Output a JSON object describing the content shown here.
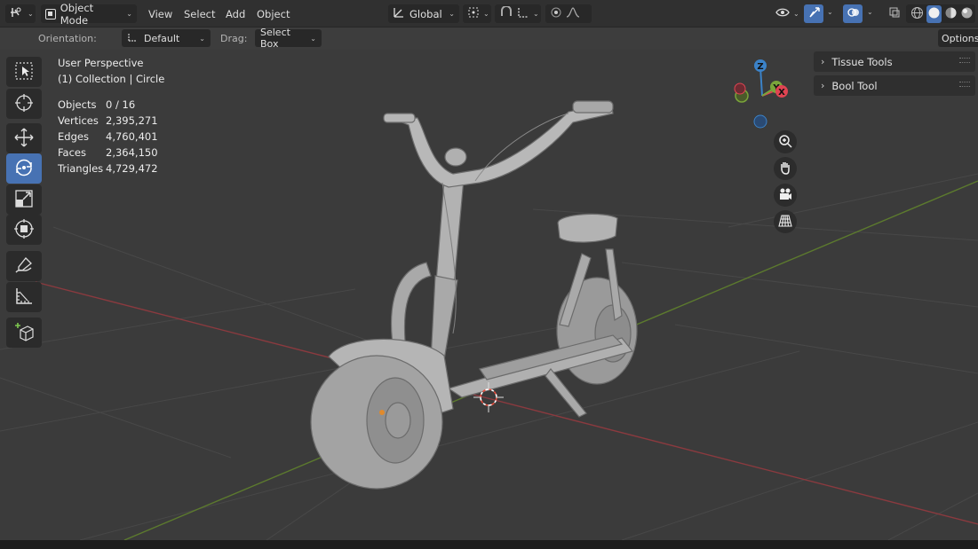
{
  "header": {
    "mode_label": "Object Mode",
    "menu": [
      "View",
      "Select",
      "Add",
      "Object"
    ],
    "transform_orientation": "Global"
  },
  "tool_settings": {
    "orientation_label": "Orientation:",
    "orientation_value": "Default",
    "drag_label": "Drag:",
    "drag_value": "Select Box",
    "options_label": "Options"
  },
  "viewport_info": {
    "view_name": "User Perspective",
    "collection": "(1) Collection | Circle"
  },
  "stats": [
    {
      "label": "Objects",
      "value": "0 / 16"
    },
    {
      "label": "Vertices",
      "value": "2,395,271"
    },
    {
      "label": "Edges",
      "value": "4,760,401"
    },
    {
      "label": "Faces",
      "value": "2,364,150"
    },
    {
      "label": "Triangles",
      "value": "4,729,472"
    }
  ],
  "panels": [
    {
      "label": "Tissue Tools"
    },
    {
      "label": "Bool Tool"
    }
  ],
  "gizmo": {
    "z": "Z",
    "y": "Y",
    "x": "X"
  },
  "colors": {
    "accent": "#4772b3",
    "x_axis": "#e04452",
    "y_axis": "#7aa53a",
    "z_axis": "#3b82c8",
    "viewport_bg": "#3b3b3b"
  },
  "icons": [
    "editor-type-icon",
    "object-mode-icon",
    "orientation-icon",
    "pivot-icon",
    "snap-icon",
    "proportional-icon",
    "visibility-icon",
    "gizmo-icon",
    "overlay-icon",
    "xray-icon",
    "shading-wireframe-icon",
    "shading-solid-icon",
    "shading-material-icon",
    "shading-rendered-icon",
    "select-box-tool-icon",
    "cursor-tool-icon",
    "move-tool-icon",
    "rotate-tool-icon",
    "scale-tool-icon",
    "transform-tool-icon",
    "annotate-tool-icon",
    "measure-tool-icon",
    "add-cube-tool-icon",
    "zoom-icon",
    "pan-hand-icon",
    "camera-icon",
    "grid-perspective-icon"
  ]
}
